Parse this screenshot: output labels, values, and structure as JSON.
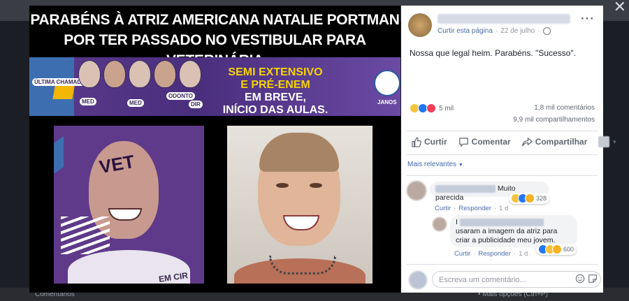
{
  "photo": {
    "headline_line1": "PARABÉNS À ATRIZ AMERICANA NATALIE PORTMAN",
    "headline_line2": "POR TER PASSADO NO VESTIBULAR PARA VETERINÁRIA",
    "banner": {
      "line1": "SEMI EXTENSIVO",
      "line2": "E PRÉ-ENEM",
      "line3": "EM BREVE,",
      "line4": "INÍCIO DAS AULAS.",
      "left_tag": "ÚLTIMA CHAMADA",
      "logo_text": "JANOS",
      "face_labels": [
        "MED",
        "MED",
        "ODONTO",
        "DIR"
      ]
    },
    "poster_tag": "VET",
    "poster_bottom_text": "EM CIR",
    "footer_left": "Comentários",
    "footer_right": "• Mais opções (Ctrl+P)"
  },
  "post": {
    "page_link": "Curtir esta página",
    "date": "22 de julho",
    "text": "Nossa que legal heim. Parabéns. \"Sucesso\".",
    "reactions_count": "5 mil",
    "comments_count": "1,8 mil comentários",
    "shares_count": "9,9 mil compartilhamentos",
    "actions": {
      "like": "Curtir",
      "comment": "Comentar",
      "share": "Compartilhar"
    },
    "sort_label": "Mais relevantes",
    "comments": [
      {
        "text": "Muito parecida",
        "like": "Curtir",
        "reply": "Responder",
        "time": "1 d",
        "reactions": "328"
      },
      {
        "text_line1": "I",
        "text_line2": "usaram a imagem da atriz para",
        "text_line3": "criar a publicidade meu jovem.",
        "like": "Curtir",
        "reply": "Responder",
        "time": "1 d",
        "reactions": "600"
      }
    ],
    "composer_placeholder": "Escreva um comentário..."
  },
  "colors": {
    "fb_blue": "#4267b2",
    "banner_yellow": "#f5d400",
    "banner_purple": "#5b3a8c"
  },
  "icons": [
    "close-icon",
    "globe-icon",
    "more-icon",
    "like-icon",
    "comment-icon",
    "share-icon",
    "chevron-down-icon",
    "emoji-icon",
    "sticker-icon"
  ]
}
